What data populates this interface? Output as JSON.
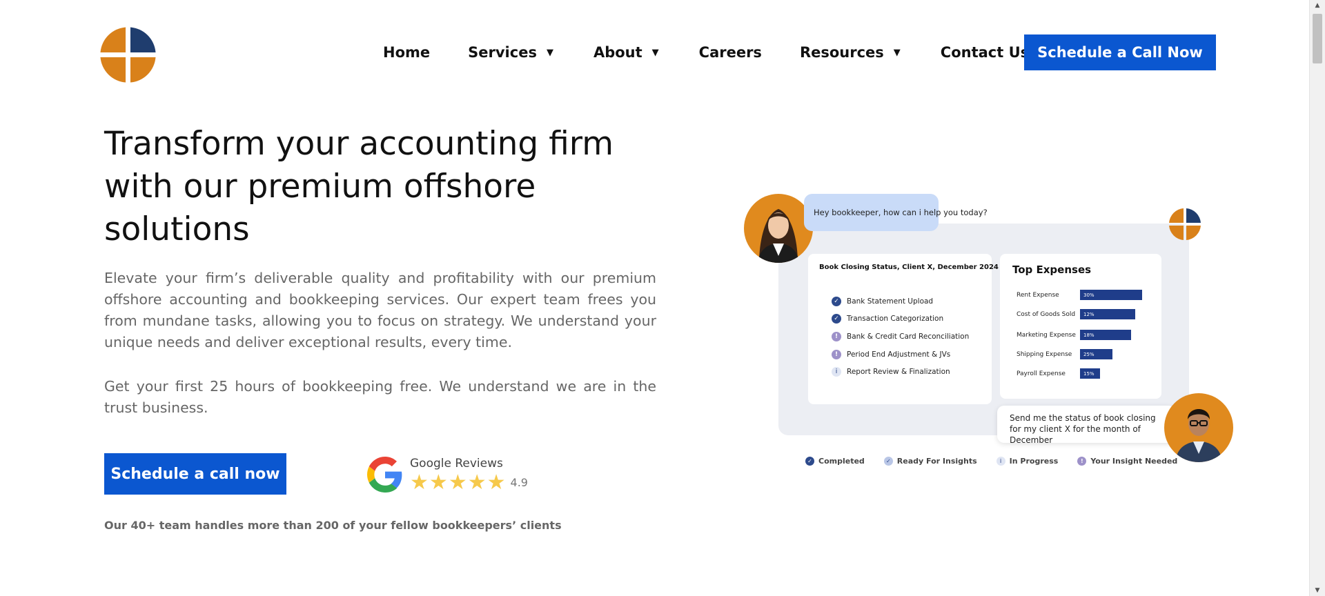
{
  "nav": {
    "items": [
      {
        "label": "Home",
        "has_dropdown": false
      },
      {
        "label": "Services",
        "has_dropdown": true
      },
      {
        "label": "About",
        "has_dropdown": true
      },
      {
        "label": "Careers",
        "has_dropdown": false
      },
      {
        "label": "Resources",
        "has_dropdown": true
      },
      {
        "label": "Contact Us",
        "has_dropdown": false
      }
    ],
    "cta_label": "Schedule a Call Now"
  },
  "hero": {
    "title": "Transform your accounting firm with our premium offshore solutions",
    "paragraph1": "Elevate your firm’s deliverable quality and profitability with our premium offshore accounting and bookkeeping services. Our expert team frees you from mundane tasks, allowing you to focus on strategy. We understand your unique needs and deliver exceptional results, every time.",
    "paragraph2": "Get your first 25 hours of bookkeeping free. We understand we are in the trust business.",
    "cta_label": "Schedule a call now",
    "reviews": {
      "label": "Google Reviews",
      "stars": 5,
      "score": "4.9"
    },
    "team_note": "Our 40+ team handles more than 200 of your fellow bookkeepers’ clients"
  },
  "illustration": {
    "question_bubble": "Hey bookkeeper, how can i help you today?",
    "answer_bubble": "Send me the status of book closing for my client X for the month of December",
    "status_card": {
      "title": "Book Closing Status, Client X, December 2024",
      "items": [
        {
          "label": "Bank Statement Upload",
          "status": "completed"
        },
        {
          "label": "Transaction Categorization",
          "status": "completed"
        },
        {
          "label": "Bank & Credit Card Reconciliation",
          "status": "insight-needed"
        },
        {
          "label": "Period End Adjustment & JVs",
          "status": "insight-needed"
        },
        {
          "label": "Report Review & Finalization",
          "status": "in-progress"
        }
      ]
    },
    "expenses_card": {
      "title": "Top Expenses",
      "items": [
        {
          "label": "Rent Expense",
          "value": "30%",
          "fraction": 0.3
        },
        {
          "label": "Cost of Goods Sold",
          "value": "12%",
          "fraction": 0.265
        },
        {
          "label": "Marketing Expense",
          "value": "18%",
          "fraction": 0.245
        },
        {
          "label": "Shipping Expense",
          "value": "25%",
          "fraction": 0.155
        },
        {
          "label": "Payroll Expense",
          "value": "15%",
          "fraction": 0.095
        }
      ]
    },
    "legend": [
      {
        "label": "Completed",
        "color": "#2d4a8c",
        "icon": "check-icon"
      },
      {
        "label": "Ready For Insights",
        "color": "#b9c6e6",
        "icon": "check-icon"
      },
      {
        "label": "In Progress",
        "color": "#dfe5f3",
        "icon": "info-icon"
      },
      {
        "label": "Your Insight Needed",
        "color": "#9d91c9",
        "icon": "exclamation-icon"
      }
    ]
  },
  "colors": {
    "brand_orange": "#d9811a",
    "brand_navy": "#1f3d6e",
    "cta_blue": "#0b57d0"
  }
}
